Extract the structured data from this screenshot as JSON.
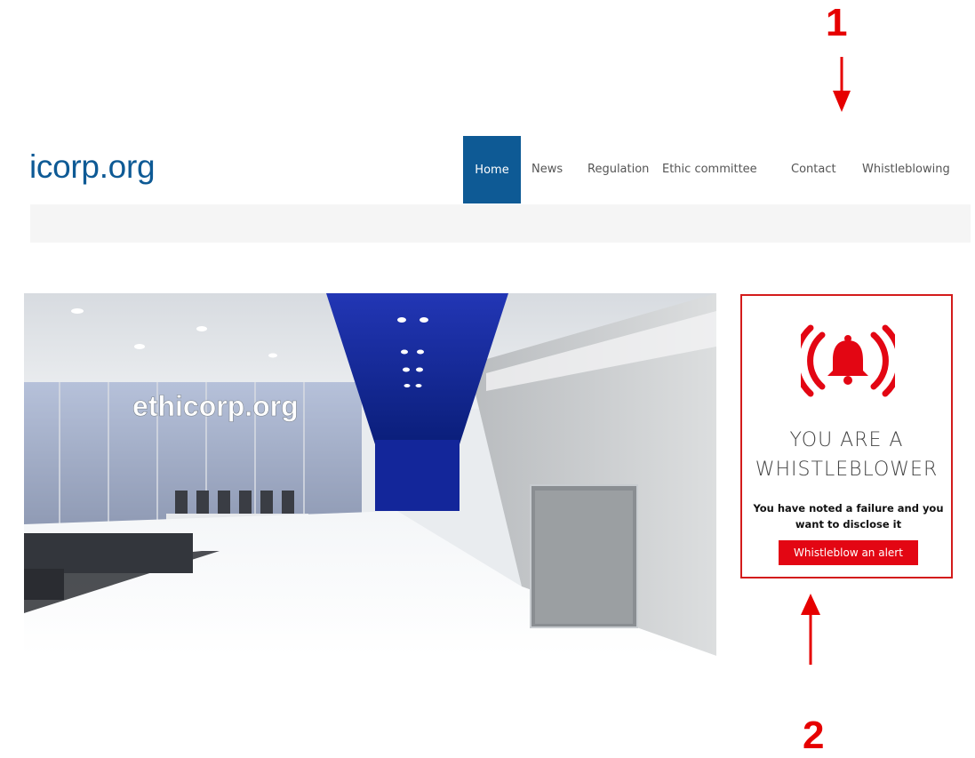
{
  "annotations": {
    "marker_1": "1",
    "marker_2": "2"
  },
  "header": {
    "logo_text": "icorp.org",
    "nav": [
      {
        "label": "Home",
        "active": true
      },
      {
        "label": "News"
      },
      {
        "label": "Regulation"
      },
      {
        "label": "Ethic committee"
      },
      {
        "label": "Contact"
      },
      {
        "label": "Whistleblowing"
      }
    ]
  },
  "hero": {
    "overlay_text": "ethicorp.org"
  },
  "whistle_card": {
    "icon": "alarm-bell-icon",
    "title_line1": "YOU ARE A",
    "title_line2": "WHISTLEBLOWER",
    "description": "You have noted a failure and you want to disclose it",
    "button_label": "Whistleblow an alert"
  },
  "colors": {
    "brand_blue": "#0e5a95",
    "alert_red": "#e30613",
    "annotation_red": "#e60000"
  }
}
